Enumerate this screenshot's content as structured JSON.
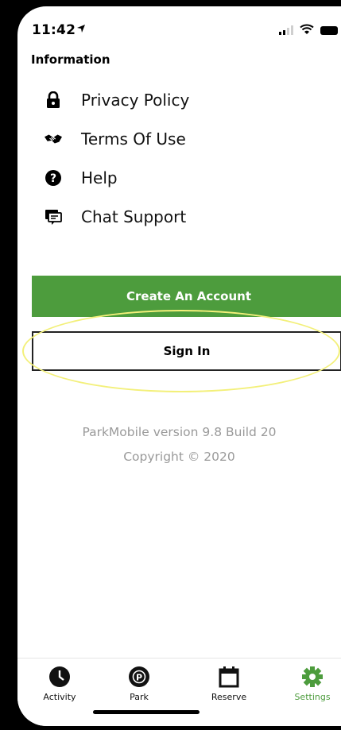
{
  "status": {
    "time": "11:42"
  },
  "information": {
    "heading": "Information",
    "items": [
      {
        "label": "Privacy Policy",
        "icon": "lock-icon"
      },
      {
        "label": "Terms Of Use",
        "icon": "handshake-icon"
      },
      {
        "label": "Help",
        "icon": "help-icon"
      },
      {
        "label": "Chat Support",
        "icon": "chat-icon"
      }
    ]
  },
  "actions": {
    "create_account": "Create An Account",
    "sign_in": "Sign In"
  },
  "version": {
    "line1": "ParkMobile version 9.8 Build 20",
    "line2": "Copyright © 2020"
  },
  "tabbar": {
    "tabs": [
      {
        "label": "Activity",
        "icon": "clock-icon"
      },
      {
        "label": "Park",
        "icon": "parkmobile-p-icon"
      },
      {
        "label": "Reserve",
        "icon": "calendar-icon"
      },
      {
        "label": "Settings",
        "icon": "gear-icon",
        "active": true
      }
    ]
  },
  "colors": {
    "accent": "#4d9c3d",
    "highlight": "#f3f07a"
  }
}
